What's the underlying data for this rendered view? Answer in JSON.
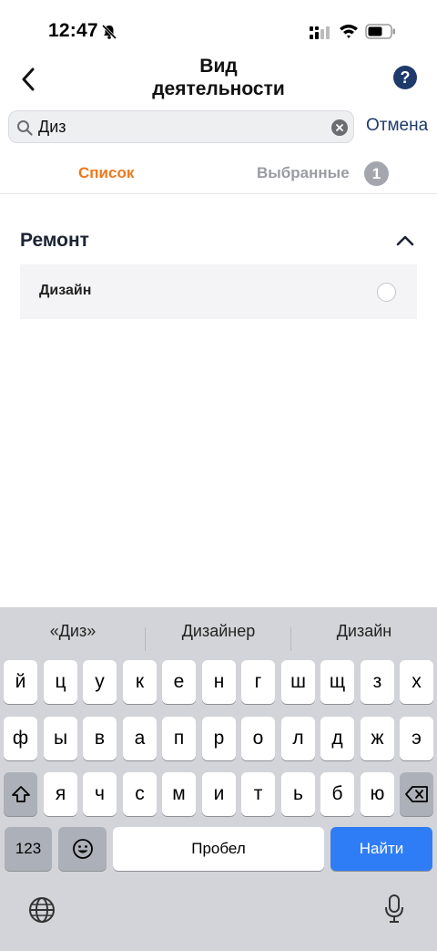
{
  "status_bar": {
    "time": "12:47"
  },
  "nav": {
    "title_line1": "Вид",
    "title_line2": "деятельности",
    "help_label": "?"
  },
  "search": {
    "value": "Диз",
    "placeholder": "",
    "cancel_label": "Отмена"
  },
  "tabs": {
    "list_label": "Список",
    "selected_label": "Выбранные",
    "selected_count": "1"
  },
  "section": {
    "title": "Ремонт",
    "items": [
      {
        "label": "Дизайн",
        "selected": false
      }
    ]
  },
  "keyboard": {
    "suggestions": [
      "«Диз»",
      "Дизайнер",
      "Дизайн"
    ],
    "row1": [
      "й",
      "ц",
      "у",
      "к",
      "е",
      "н",
      "г",
      "ш",
      "щ",
      "з",
      "х"
    ],
    "row2": [
      "ф",
      "ы",
      "в",
      "а",
      "п",
      "р",
      "о",
      "л",
      "д",
      "ж",
      "э"
    ],
    "row3": [
      "я",
      "ч",
      "с",
      "м",
      "и",
      "т",
      "ь",
      "б",
      "ю"
    ],
    "numbers_label": "123",
    "space_label": "Пробел",
    "action_label": "Найти"
  },
  "colors": {
    "accent_orange": "#ee7a1e",
    "navy": "#1f3a6b",
    "key_blue": "#2f7df6"
  },
  "icons": [
    "bell-off-icon",
    "signal-icon",
    "wifi-icon",
    "battery-icon",
    "back-chevron-icon",
    "help-icon",
    "search-icon",
    "clear-icon",
    "chevron-up-icon",
    "shift-icon",
    "backspace-icon",
    "emoji-icon",
    "globe-icon",
    "mic-icon"
  ]
}
